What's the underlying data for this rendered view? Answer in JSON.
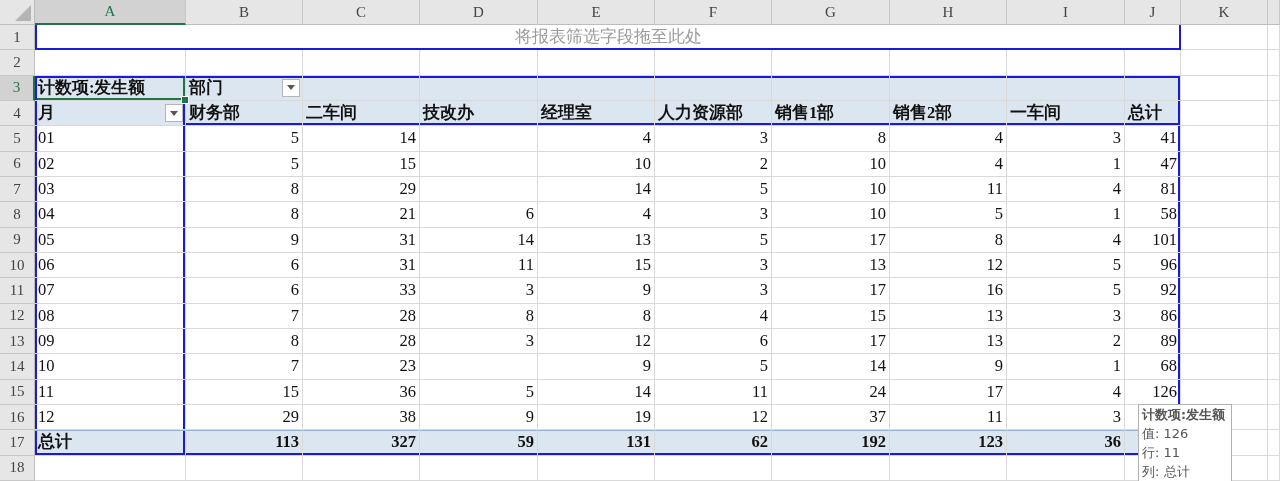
{
  "column_headers": [
    {
      "label": "A",
      "selected": true
    },
    {
      "label": "B",
      "selected": false
    },
    {
      "label": "C",
      "selected": false
    },
    {
      "label": "D",
      "selected": false
    },
    {
      "label": "E",
      "selected": false
    },
    {
      "label": "F",
      "selected": false
    },
    {
      "label": "G",
      "selected": false
    },
    {
      "label": "H",
      "selected": false
    },
    {
      "label": "I",
      "selected": false
    },
    {
      "label": "J",
      "selected": false
    },
    {
      "label": "K",
      "selected": false
    }
  ],
  "row_headers": [
    {
      "label": "1",
      "selected": false
    },
    {
      "label": "2",
      "selected": false
    },
    {
      "label": "3",
      "selected": true
    },
    {
      "label": "4",
      "selected": false
    },
    {
      "label": "5",
      "selected": false
    },
    {
      "label": "6",
      "selected": false
    },
    {
      "label": "7",
      "selected": false
    },
    {
      "label": "8",
      "selected": false
    },
    {
      "label": "9",
      "selected": false
    },
    {
      "label": "10",
      "selected": false
    },
    {
      "label": "11",
      "selected": false
    },
    {
      "label": "12",
      "selected": false
    },
    {
      "label": "13",
      "selected": false
    },
    {
      "label": "14",
      "selected": false
    },
    {
      "label": "15",
      "selected": false
    },
    {
      "label": "16",
      "selected": false
    },
    {
      "label": "17",
      "selected": false
    },
    {
      "label": "18",
      "selected": false
    }
  ],
  "filter_drop_zone": "将报表筛选字段拖至此处",
  "pivot": {
    "value_field": {
      "label": "计数项:发生额",
      "selected": true
    },
    "column_field": "部门",
    "row_field": "月",
    "columns": [
      "财务部",
      "二车间",
      "技改办",
      "经理室",
      "人力资源部",
      "销售1部",
      "销售2部",
      "一车间",
      "总计"
    ],
    "rows": [
      {
        "label": "01",
        "B": "5",
        "C": "14",
        "E": "4",
        "F": "3",
        "G": "8",
        "H": "4",
        "I": "3",
        "J": "41"
      },
      {
        "label": "02",
        "B": "5",
        "C": "15",
        "E": "10",
        "F": "2",
        "G": "10",
        "H": "4",
        "I": "1",
        "J": "47"
      },
      {
        "label": "03",
        "B": "8",
        "C": "29",
        "E": "14",
        "F": "5",
        "G": "10",
        "H": "11",
        "I": "4",
        "J": "81"
      },
      {
        "label": "04",
        "B": "8",
        "C": "21",
        "D": "6",
        "E": "4",
        "F": "3",
        "G": "10",
        "H": "5",
        "I": "1",
        "J": "58"
      },
      {
        "label": "05",
        "B": "9",
        "C": "31",
        "D": "14",
        "E": "13",
        "F": "5",
        "G": "17",
        "H": "8",
        "I": "4",
        "J": "101"
      },
      {
        "label": "06",
        "B": "6",
        "C": "31",
        "D": "11",
        "E": "15",
        "F": "3",
        "G": "13",
        "H": "12",
        "I": "5",
        "J": "96"
      },
      {
        "label": "07",
        "B": "6",
        "C": "33",
        "D": "3",
        "E": "9",
        "F": "3",
        "G": "17",
        "H": "16",
        "I": "5",
        "J": "92"
      },
      {
        "label": "08",
        "B": "7",
        "C": "28",
        "D": "8",
        "E": "8",
        "F": "4",
        "G": "15",
        "H": "13",
        "I": "3",
        "J": "86"
      },
      {
        "label": "09",
        "B": "8",
        "C": "28",
        "D": "3",
        "E": "12",
        "F": "6",
        "G": "17",
        "H": "13",
        "I": "2",
        "J": "89"
      },
      {
        "label": "10",
        "B": "7",
        "C": "23",
        "E": "9",
        "F": "5",
        "G": "14",
        "H": "9",
        "I": "1",
        "J": "68"
      },
      {
        "label": "11",
        "B": "15",
        "C": "36",
        "D": "5",
        "E": "14",
        "F": "11",
        "G": "24",
        "H": "17",
        "I": "4",
        "J": "126"
      },
      {
        "label": "12",
        "B": "29",
        "C": "38",
        "D": "9",
        "E": "19",
        "F": "12",
        "G": "37",
        "H": "11",
        "I": "3"
      }
    ],
    "total": {
      "label": "总计",
      "B": "113",
      "C": "327",
      "D": "59",
      "E": "131",
      "F": "62",
      "G": "192",
      "H": "123",
      "I": "36"
    }
  },
  "tooltip": {
    "title": "计数项:发生额",
    "lines": [
      "值: 126",
      "行: 11",
      "列: 总计"
    ]
  }
}
